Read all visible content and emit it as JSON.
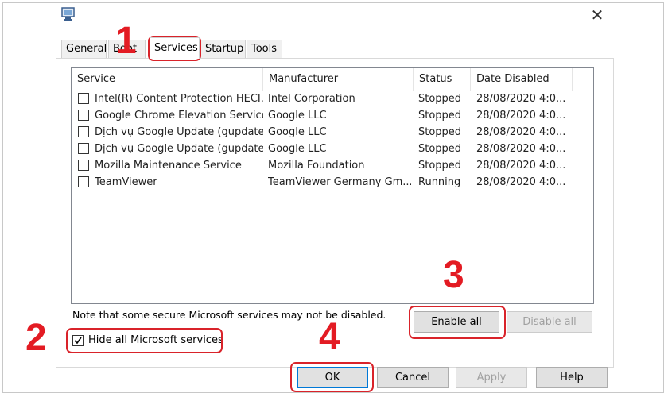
{
  "window": {
    "close_glyph": "✕"
  },
  "tabs": [
    {
      "label": "General",
      "active": false
    },
    {
      "label": "Boot",
      "active": false
    },
    {
      "label": "Services",
      "active": true
    },
    {
      "label": "Startup",
      "active": false
    },
    {
      "label": "Tools",
      "active": false
    }
  ],
  "table": {
    "columns": [
      "Service",
      "Manufacturer",
      "Status",
      "Date Disabled"
    ],
    "rows": [
      {
        "service": "Intel(R) Content Protection HECI...",
        "manufacturer": "Intel Corporation",
        "status": "Stopped",
        "date": "28/08/2020 4:0...",
        "checked": false
      },
      {
        "service": "Google Chrome Elevation Service",
        "manufacturer": "Google LLC",
        "status": "Stopped",
        "date": "28/08/2020 4:0...",
        "checked": false
      },
      {
        "service": "Dịch vụ Google Update (gupdate)",
        "manufacturer": "Google LLC",
        "status": "Stopped",
        "date": "28/08/2020 4:0...",
        "checked": false
      },
      {
        "service": "Dịch vụ Google Update (gupdate...",
        "manufacturer": "Google LLC",
        "status": "Stopped",
        "date": "28/08/2020 4:0...",
        "checked": false
      },
      {
        "service": "Mozilla Maintenance Service",
        "manufacturer": "Mozilla Foundation",
        "status": "Stopped",
        "date": "28/08/2020 4:0...",
        "checked": false
      },
      {
        "service": "TeamViewer",
        "manufacturer": "TeamViewer Germany Gm...",
        "status": "Running",
        "date": "28/08/2020 4:0...",
        "checked": false
      }
    ]
  },
  "note": "Note that some secure Microsoft services may not be disabled.",
  "hide_ms": {
    "label": "Hide all Microsoft services",
    "checked": true
  },
  "buttons": {
    "enable_all": "Enable all",
    "disable_all": "Disable all",
    "ok": "OK",
    "cancel": "Cancel",
    "apply": "Apply",
    "help": "Help"
  },
  "annotations": {
    "n1": "1",
    "n2": "2",
    "n3": "3",
    "n4": "4"
  },
  "colors": {
    "annotation": "#e31b23",
    "focus": "#0078d7"
  }
}
